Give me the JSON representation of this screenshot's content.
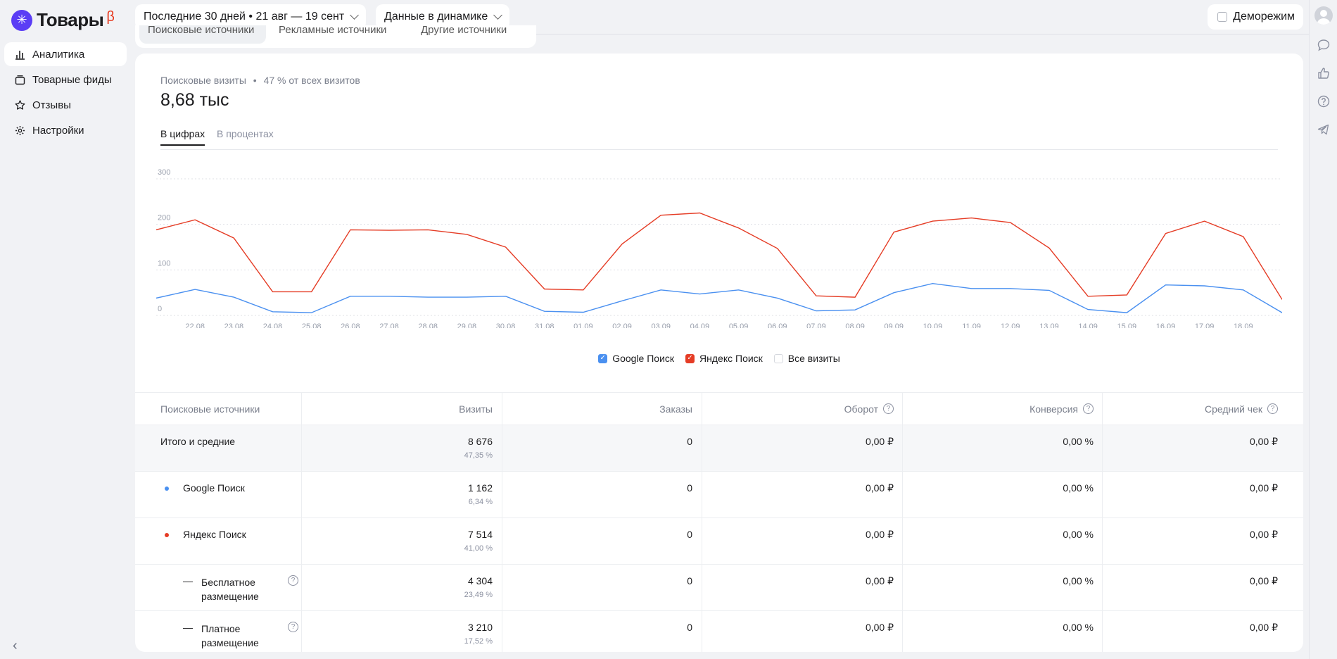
{
  "app": {
    "logo_glyph": "✳",
    "logo_text": "Товары",
    "beta": "β"
  },
  "nav": [
    {
      "label": "Аналитика",
      "icon": "bar-chart-icon",
      "active": true
    },
    {
      "label": "Товарные фиды",
      "icon": "feed-icon",
      "active": false
    },
    {
      "label": "Отзывы",
      "icon": "star-icon",
      "active": false
    },
    {
      "label": "Настройки",
      "icon": "gear-icon",
      "active": false
    }
  ],
  "topbar": {
    "period": "Последние 30 дней • 21 авг — 19 сент",
    "mode": "Данные в динамике",
    "demo_label": "Деморежим"
  },
  "source_tabs": [
    "Поисковые источники",
    "Рекламные источники",
    "Другие источники"
  ],
  "card": {
    "subtitle": "Поисковые визиты",
    "subtitle_share": "47 % от всех визитов",
    "total": "8,68 тыс",
    "tabs": {
      "numbers": "В цифрах",
      "percent": "В процентах"
    }
  },
  "chart_data": {
    "type": "line",
    "ylim": [
      0,
      300
    ],
    "yticks": [
      0,
      100,
      200,
      300
    ],
    "x": [
      "21.08",
      "22.08",
      "23.08",
      "24.08",
      "25.08",
      "26.08",
      "27.08",
      "28.08",
      "29.08",
      "30.08",
      "31.08",
      "01.09",
      "02.09",
      "03.09",
      "04.09",
      "05.09",
      "06.09",
      "07.09",
      "08.09",
      "09.09",
      "10.09",
      "11.09",
      "12.09",
      "13.09",
      "14.09",
      "15.09",
      "16.09",
      "17.09",
      "18.09",
      "19.09"
    ],
    "xtick_labels": [
      "22.08",
      "23.08",
      "24.08",
      "25.08",
      "26.08",
      "27.08",
      "28.08",
      "29.08",
      "30.08",
      "31.08",
      "01.09",
      "02.09",
      "03.09",
      "04.09",
      "05.09",
      "06.09",
      "07.09",
      "08.09",
      "09.09",
      "10.09",
      "11.09",
      "12.09",
      "13.09",
      "14.09",
      "15.09",
      "16.09",
      "17.09",
      "18.09"
    ],
    "series": [
      {
        "name": "Google Поиск",
        "color": "#4a90f0",
        "values": [
          38,
          57,
          40,
          8,
          6,
          42,
          42,
          40,
          40,
          42,
          9,
          7,
          32,
          56,
          47,
          56,
          38,
          10,
          12,
          50,
          70,
          59,
          59,
          55,
          13,
          6,
          67,
          65,
          56,
          6
        ]
      },
      {
        "name": "Яндекс Поиск",
        "color": "#e53c25",
        "values": [
          188,
          210,
          170,
          52,
          52,
          188,
          187,
          188,
          178,
          150,
          58,
          56,
          157,
          220,
          225,
          192,
          147,
          43,
          40,
          183,
          207,
          214,
          204,
          148,
          42,
          45,
          180,
          207,
          173,
          35
        ]
      }
    ],
    "legend": [
      {
        "name": "Google Поиск",
        "color": "#4a90f0",
        "checked": true
      },
      {
        "name": "Яндекс Поиск",
        "color": "#e53c25",
        "checked": true
      },
      {
        "name": "Все визиты",
        "color": "#c8cbd3",
        "checked": false
      }
    ],
    "grid": true
  },
  "table": {
    "headers": [
      "Поисковые источники",
      "Визиты",
      "Заказы",
      "Оборот",
      "Конверсия",
      "Средний чек"
    ],
    "rows": [
      {
        "name": "Итого и средние",
        "visits": "8 676",
        "share": "47,35 %",
        "orders": "0",
        "turnover": "0,00 ₽",
        "conversion": "0,00 %",
        "avg": "0,00 ₽"
      },
      {
        "name": "Google Поиск",
        "visits": "1 162",
        "share": "6,34 %",
        "orders": "0",
        "turnover": "0,00 ₽",
        "conversion": "0,00 %",
        "avg": "0,00 ₽",
        "dot": "#4a90f0"
      },
      {
        "name": "Яндекс Поиск",
        "visits": "7 514",
        "share": "41,00 %",
        "orders": "0",
        "turnover": "0,00 ₽",
        "conversion": "0,00 %",
        "avg": "0,00 ₽",
        "dot": "#e53c25"
      },
      {
        "name": "Бесплатное размещение",
        "visits": "4 304",
        "share": "23,49 %",
        "orders": "0",
        "turnover": "0,00 ₽",
        "conversion": "0,00 %",
        "avg": "0,00 ₽",
        "child": true
      },
      {
        "name": "Платное размещение",
        "visits": "3 210",
        "share": "17,52 %",
        "orders": "0",
        "turnover": "0,00 ₽",
        "conversion": "0,00 %",
        "avg": "0,00 ₽",
        "child": true
      }
    ],
    "dash": "—",
    "help_glyph": "?"
  },
  "misc": {
    "collapse_glyph": "‹"
  }
}
